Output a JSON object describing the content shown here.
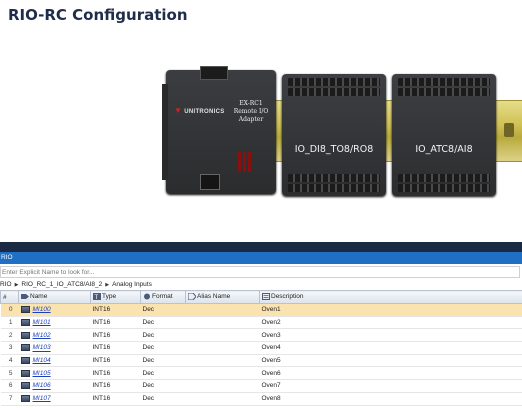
{
  "page": {
    "title": "RIO-RC Configuration"
  },
  "hardware": {
    "adapter": {
      "brand": "UNITRONICS",
      "model_line1": "EX-RC1",
      "model_line2": "Remote I/O Adapter"
    },
    "modules": [
      {
        "label": "IO_DI8_TO8/RO8"
      },
      {
        "label": "IO_ATC8/AI8"
      }
    ]
  },
  "panel": {
    "header": "RIO",
    "search_placeholder": "Enter Explicit Name to look for...",
    "breadcrumb": [
      "RIO",
      "RIO_RC_1_IO_ATC8/AI8_2",
      "Analog Inputs"
    ]
  },
  "table": {
    "columns": [
      "#",
      "Name",
      "Type",
      "Format",
      "Alias Name",
      "Description"
    ],
    "rows": [
      {
        "index": "0",
        "name": "MI100",
        "type": "INT16",
        "format": "Dec",
        "alias": "",
        "description": "Oven1",
        "selected": true
      },
      {
        "index": "1",
        "name": "MI101",
        "type": "INT16",
        "format": "Dec",
        "alias": "",
        "description": "Oven2"
      },
      {
        "index": "2",
        "name": "MI102",
        "type": "INT16",
        "format": "Dec",
        "alias": "",
        "description": "Oven3"
      },
      {
        "index": "3",
        "name": "MI103",
        "type": "INT16",
        "format": "Dec",
        "alias": "",
        "description": "Oven4"
      },
      {
        "index": "4",
        "name": "MI104",
        "type": "INT16",
        "format": "Dec",
        "alias": "",
        "description": "Oven5"
      },
      {
        "index": "5",
        "name": "MI105",
        "type": "INT16",
        "format": "Dec",
        "alias": "",
        "description": "Oven6"
      },
      {
        "index": "6",
        "name": "MI106",
        "type": "INT16",
        "format": "Dec",
        "alias": "",
        "description": "Oven7"
      },
      {
        "index": "7",
        "name": "MI107",
        "type": "INT16",
        "format": "Dec",
        "alias": "",
        "description": "Oven8"
      }
    ]
  },
  "colors": {
    "header_blue": "#1f6fc5",
    "divider_navy": "#1b2a44",
    "selected_row": "#fbe3b0",
    "link": "#1a3fbf"
  }
}
